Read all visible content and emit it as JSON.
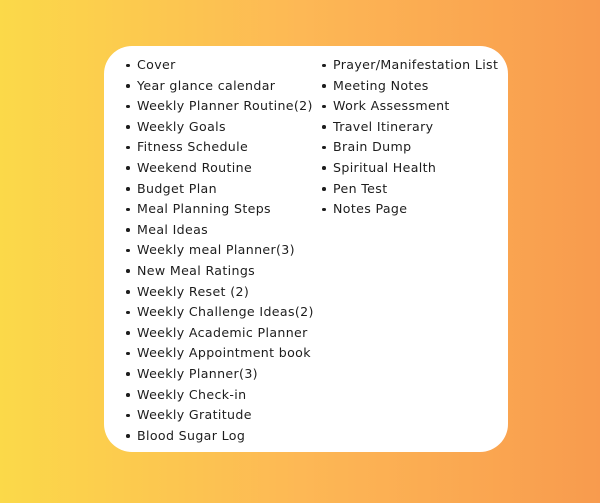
{
  "background": {
    "gradient_start": "#fbd949",
    "gradient_mid": "#fdb855",
    "gradient_end": "#f89b4e",
    "direction": "horizontal-left-to-right"
  },
  "card": {
    "background_color": "#ffffff",
    "corner_radius": "28px",
    "text_color": "#1d1d1d",
    "bullet_color": "#1d1d1d"
  },
  "list": {
    "left_column": [
      {
        "label": "Cover"
      },
      {
        "label": "Year glance calendar"
      },
      {
        "label": "Weekly Planner Routine(2)"
      },
      {
        "label": "Weekly Goals"
      },
      {
        "label": "Fitness Schedule"
      },
      {
        "label": "Weekend Routine"
      },
      {
        "label": "Budget Plan"
      },
      {
        "label": "Meal Planning Steps"
      },
      {
        "label": "Meal Ideas"
      },
      {
        "label": "Weekly meal Planner(3)"
      },
      {
        "label": "New Meal Ratings"
      },
      {
        "label": "Weekly Reset (2)"
      },
      {
        "label": "Weekly Challenge Ideas(2)"
      },
      {
        "label": "Weekly Academic Planner"
      },
      {
        "label": "Weekly Appointment book"
      },
      {
        "label": "Weekly Planner(3)"
      },
      {
        "label": "Weekly Check-in"
      },
      {
        "label": "Weekly Gratitude"
      },
      {
        "label": "Blood Sugar Log"
      }
    ],
    "right_column": [
      {
        "label": "Prayer/Manifestation List"
      },
      {
        "label": "Meeting Notes"
      },
      {
        "label": "Work Assessment"
      },
      {
        "label": "Travel Itinerary"
      },
      {
        "label": "Brain Dump"
      },
      {
        "label": "Spiritual Health"
      },
      {
        "label": "Pen Test"
      },
      {
        "label": "Notes Page"
      }
    ]
  }
}
